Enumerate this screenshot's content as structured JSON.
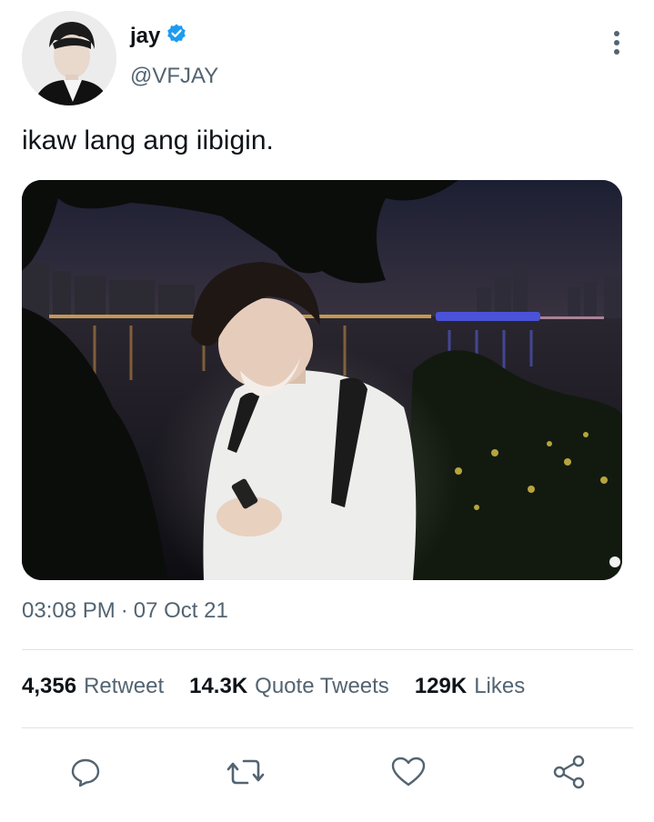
{
  "user": {
    "display_name": "jay",
    "handle": "@VFJAY",
    "verified": true,
    "verified_color": "#1d9bf0"
  },
  "tweet": {
    "text": "ikaw lang ang iibigin."
  },
  "meta": {
    "time": "03:08 PM",
    "separator": "·",
    "date": "07 Oct 21"
  },
  "stats": {
    "retweets": {
      "count": "4,356",
      "label": "Retweet"
    },
    "quotes": {
      "count": "14.3K",
      "label": "Quote Tweets"
    },
    "likes": {
      "count": "129K",
      "label": "Likes"
    }
  },
  "actions": {
    "reply_icon": "comment-icon",
    "retweet_icon": "retweet-icon",
    "like_icon": "heart-icon",
    "share_icon": "share-icon"
  },
  "colors": {
    "text_primary": "#0f1419",
    "text_secondary": "#536471",
    "divider": "#dfe3e6"
  }
}
